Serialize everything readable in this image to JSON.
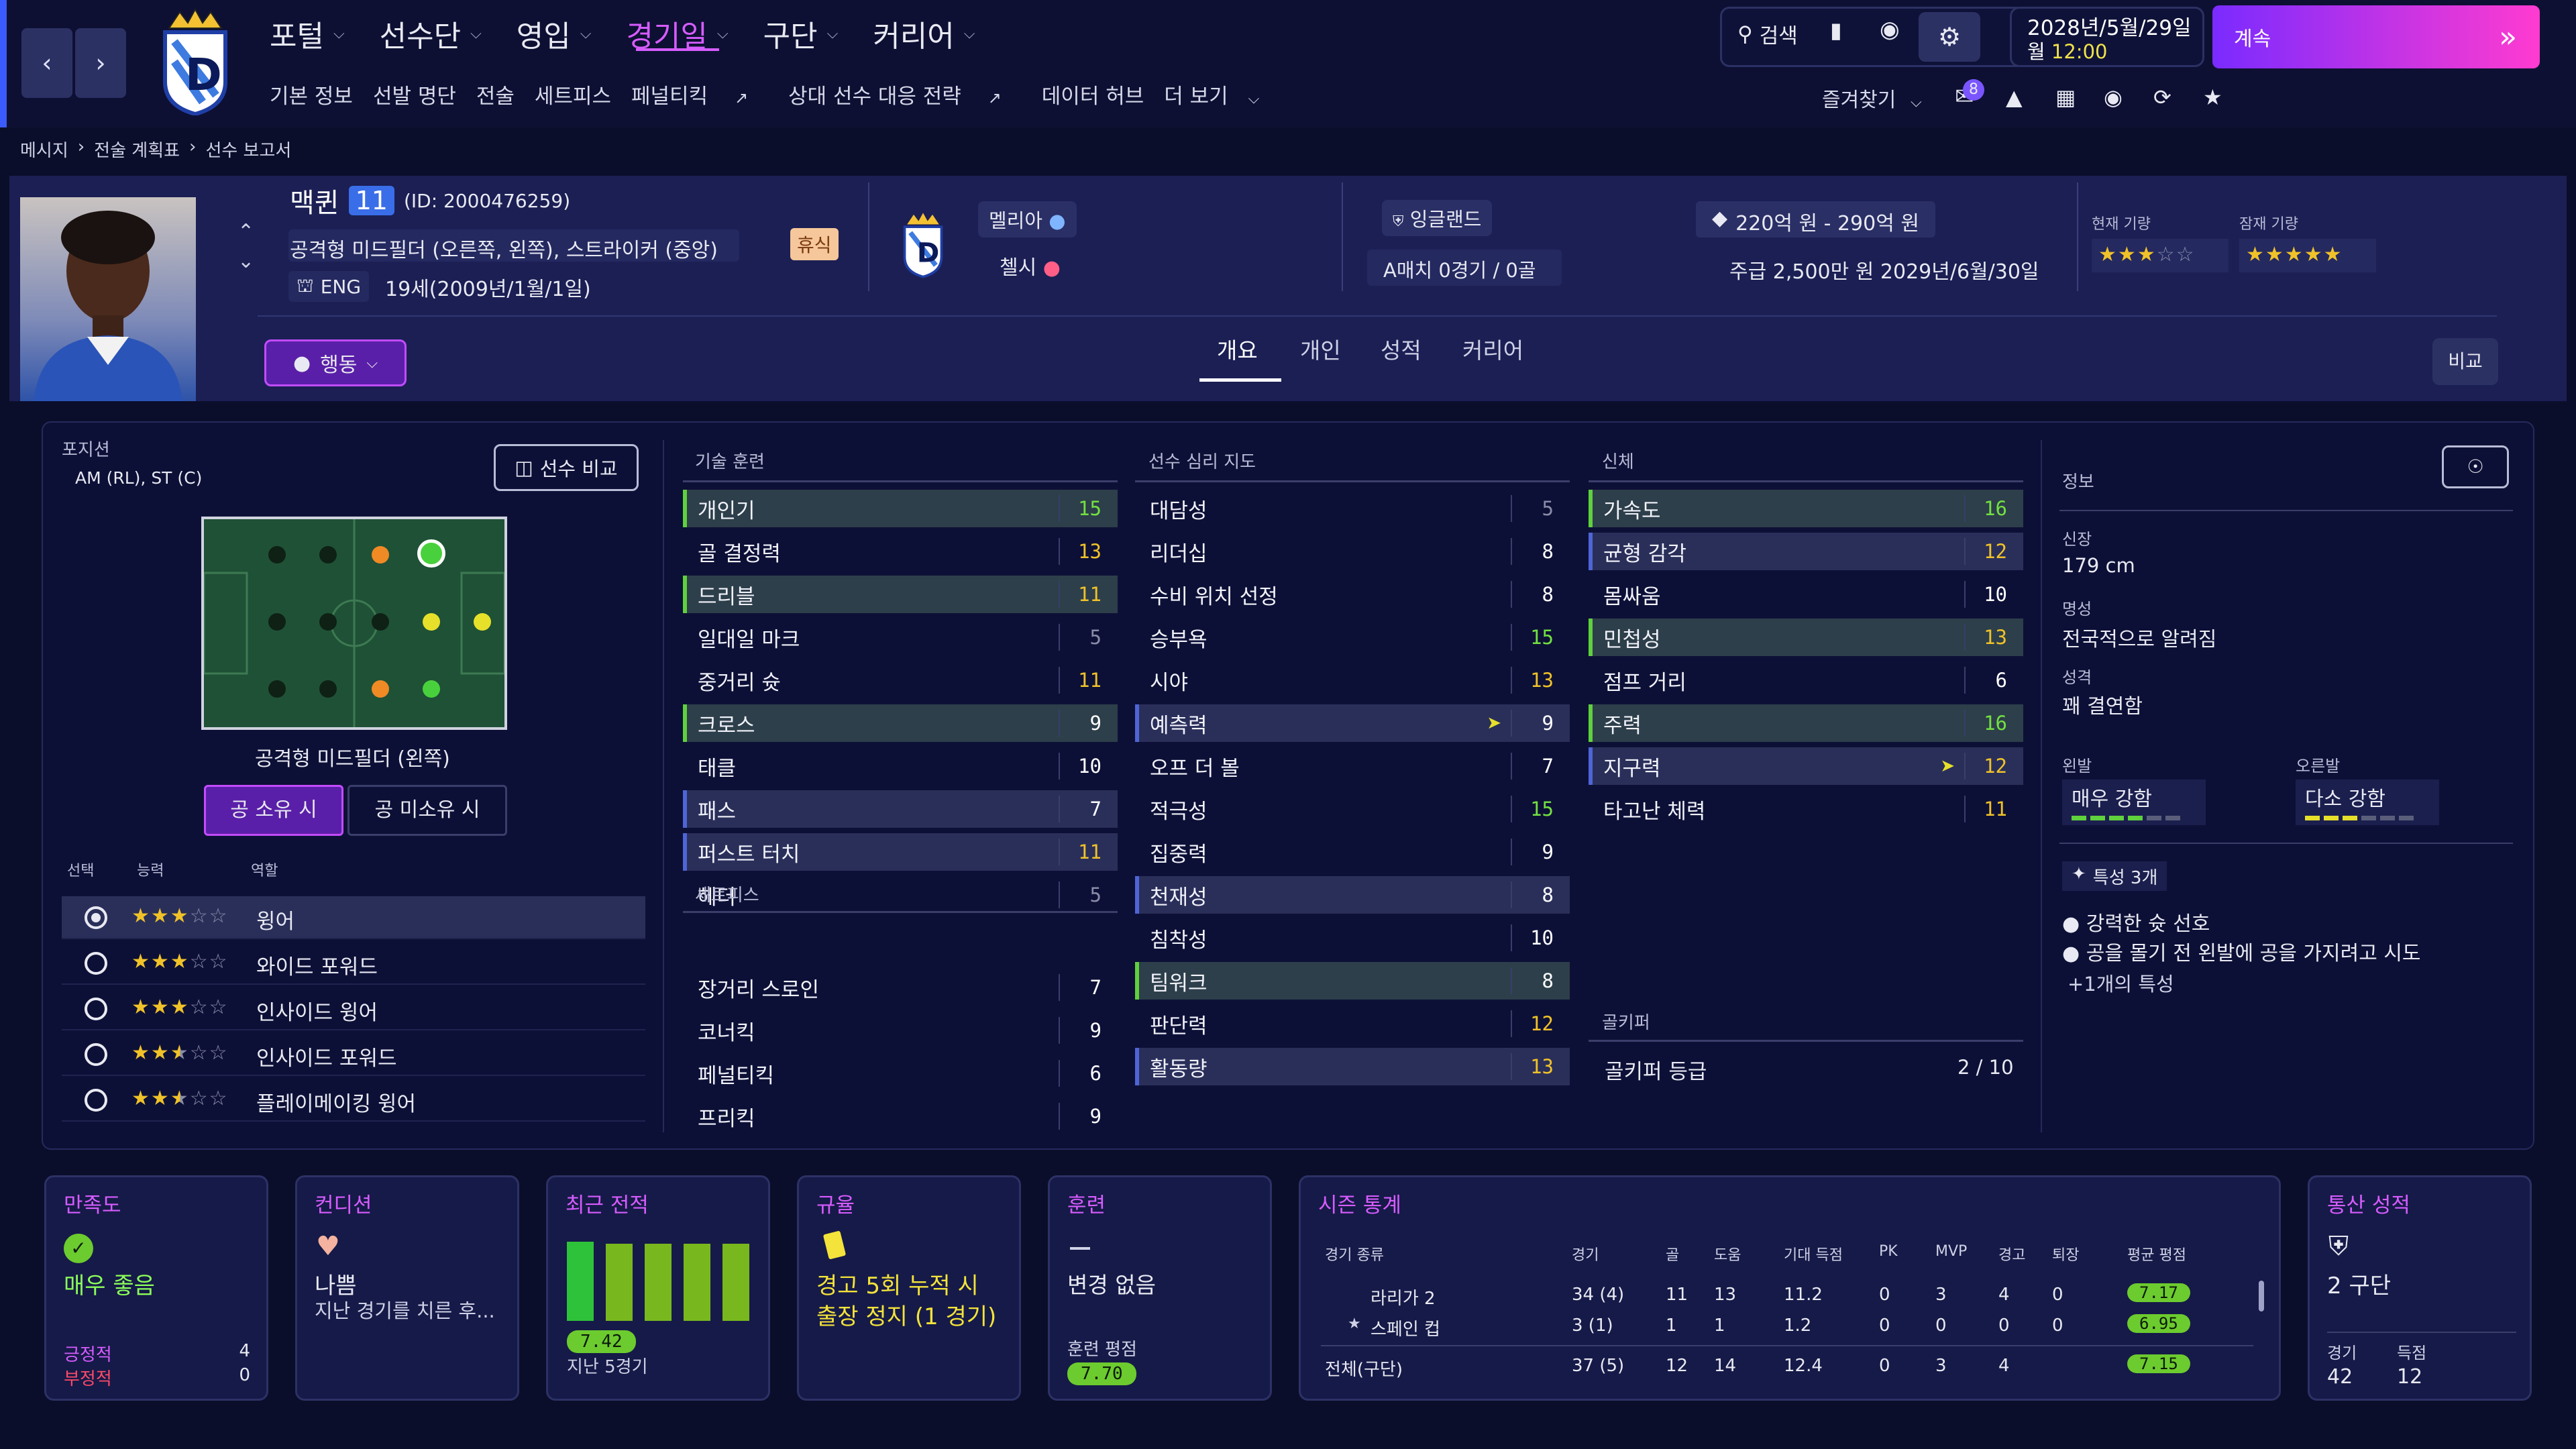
{
  "topbar": {
    "nav": [
      {
        "label": "포털",
        "active": false
      },
      {
        "label": "선수단",
        "active": false
      },
      {
        "label": "영입",
        "active": false
      },
      {
        "label": "경기일",
        "active": true
      },
      {
        "label": "구단",
        "active": false
      },
      {
        "label": "커리어",
        "active": false
      }
    ],
    "subnav": [
      "기본 정보",
      "선발 명단",
      "전술",
      "세트피스",
      "페널티킥",
      "상대 선수 대응 전략",
      "데이터 허브",
      "더 보기"
    ],
    "search_label": "검색",
    "date": "2028년/5월/29일",
    "day": "월",
    "time": "12:00",
    "continue_label": "계속",
    "favorites_label": "즐겨찾기",
    "notification_count": "8",
    "colors": {
      "accent": "#d65cff",
      "continue_start": "#7a2bff",
      "continue_end": "#ff3bd0"
    }
  },
  "breadcrumb": [
    "메시지",
    "전술 계획표",
    "선수 보고서"
  ],
  "player": {
    "name": "맥퀸",
    "number": "11",
    "id": "(ID: 2000476259)",
    "positions": "공격형 미드필더 (오른쪽, 왼쪽), 스트라이커 (중앙)",
    "status": "휴식",
    "nation": "ENG",
    "age": "19세(2009년/1월/1일)",
    "club": "멜리아",
    "loan_club": "첼시",
    "national_team": "잉글랜드",
    "caps": "A매치 0경기 / 0골",
    "value": "220억 원 - 290억 원",
    "contract": "주급 2,500만 원 2029년/6월/30일",
    "current_ability_label": "현재 기량",
    "current_ability": 3,
    "potential_label": "잠재 기량",
    "potential": 5,
    "action_label": "행동",
    "compare_label": "비교"
  },
  "tabs": [
    "개요",
    "개인",
    "성적",
    "커리어"
  ],
  "position_panel": {
    "title": "포지션",
    "positions_short": "AM (RL), ST (C)",
    "compare_button": "선수 비교",
    "selected_position": "공격형 미드필더 (왼쪽)",
    "toggle": [
      "공 소유 시",
      "공 미소유 시"
    ],
    "headers": [
      "선택",
      "능력",
      "역할"
    ],
    "roles": [
      {
        "name": "윙어",
        "stars": 3,
        "selected": true
      },
      {
        "name": "와이드 포워드",
        "stars": 3,
        "selected": false
      },
      {
        "name": "인사이드 윙어",
        "stars": 3,
        "selected": false
      },
      {
        "name": "인사이드 포워드",
        "stars": 2.5,
        "selected": false
      },
      {
        "name": "플레이메이킹 윙어",
        "stars": 2.5,
        "selected": false
      }
    ]
  },
  "technical": {
    "title": "기술 훈련",
    "attrs": [
      {
        "name": "개인기",
        "value": "15",
        "style": "g"
      },
      {
        "name": "골 결정력",
        "value": "13",
        "style": ""
      },
      {
        "name": "드리블",
        "value": "11",
        "style": "g"
      },
      {
        "name": "일대일 마크",
        "value": "5",
        "style": ""
      },
      {
        "name": "중거리 슛",
        "value": "11",
        "style": ""
      },
      {
        "name": "크로스",
        "value": "9",
        "style": "g"
      },
      {
        "name": "태클",
        "value": "10",
        "style": ""
      },
      {
        "name": "패스",
        "value": "7",
        "style": "b"
      },
      {
        "name": "퍼스트 터치",
        "value": "11",
        "style": "b"
      },
      {
        "name": "헤더",
        "value": "5",
        "style": ""
      }
    ],
    "setpiece_title": "세트피스",
    "setpieces": [
      {
        "name": "장거리 스로인",
        "value": "7",
        "style": ""
      },
      {
        "name": "코너킥",
        "value": "9",
        "style": ""
      },
      {
        "name": "페널티킥",
        "value": "6",
        "style": ""
      },
      {
        "name": "프리킥",
        "value": "9",
        "style": ""
      }
    ]
  },
  "mental": {
    "title": "선수 심리 지도",
    "attrs": [
      {
        "name": "대담성",
        "value": "5",
        "style": ""
      },
      {
        "name": "리더십",
        "value": "8",
        "style": ""
      },
      {
        "name": "수비 위치 선정",
        "value": "8",
        "style": ""
      },
      {
        "name": "승부욕",
        "value": "15",
        "style": ""
      },
      {
        "name": "시야",
        "value": "13",
        "style": ""
      },
      {
        "name": "예측력",
        "value": "9",
        "style": "b"
      },
      {
        "name": "오프 더 볼",
        "value": "7",
        "style": ""
      },
      {
        "name": "적극성",
        "value": "15",
        "style": ""
      },
      {
        "name": "집중력",
        "value": "9",
        "style": ""
      },
      {
        "name": "천재성",
        "value": "8",
        "style": "b"
      },
      {
        "name": "침착성",
        "value": "10",
        "style": ""
      },
      {
        "name": "팀워크",
        "value": "8",
        "style": "g"
      },
      {
        "name": "판단력",
        "value": "12",
        "style": ""
      },
      {
        "name": "활동량",
        "value": "13",
        "style": "b"
      }
    ]
  },
  "physical": {
    "title": "신체",
    "attrs": [
      {
        "name": "가속도",
        "value": "16",
        "style": "g"
      },
      {
        "name": "균형 감각",
        "value": "12",
        "style": "b"
      },
      {
        "name": "몸싸움",
        "value": "10",
        "style": ""
      },
      {
        "name": "민첩성",
        "value": "13",
        "style": "g"
      },
      {
        "name": "점프 거리",
        "value": "6",
        "style": ""
      },
      {
        "name": "주력",
        "value": "16",
        "style": "g"
      },
      {
        "name": "지구력",
        "value": "12",
        "style": "b"
      },
      {
        "name": "타고난 체력",
        "value": "11",
        "style": ""
      }
    ],
    "gk_title": "골키퍼",
    "gk_label": "골키퍼 등급",
    "gk_value": "2 / 10"
  },
  "info": {
    "title": "정보",
    "height_label": "신장",
    "height": "179 cm",
    "fame_label": "명성",
    "fame": "전국적으로 알려짐",
    "personality_label": "성격",
    "personality": "꽤 결연함",
    "left_foot_label": "왼발",
    "left_foot": "매우 강함",
    "left_foot_level": 0.8,
    "right_foot_label": "오른발",
    "right_foot": "다소 강함",
    "right_foot_level": 0.6,
    "traits_label": "특성 3개",
    "traits": [
      "강력한 슛 선호",
      "공을 몰기 전 왼발에 공을 가지려고 시도"
    ],
    "more_traits": "+1개의 특성"
  },
  "cards": {
    "morale": {
      "title": "만족도",
      "value": "매우 좋음",
      "pos_label": "긍정적",
      "pos": "4",
      "neg_label": "부정적",
      "neg": "0"
    },
    "condition": {
      "title": "컨디션",
      "value": "나쁨",
      "sub": "지난 경기를 치른 후..."
    },
    "form": {
      "title": "최근 전적",
      "rating": "7.42",
      "label": "지난 5경기",
      "bars": [
        0.95,
        0.93,
        0.93,
        0.93,
        0.93
      ]
    },
    "discipline": {
      "title": "규율",
      "line1": "경고 5회 누적 시",
      "line2": "출장 정지 (1 경기)"
    },
    "training": {
      "title": "훈련",
      "value": "변경 없음",
      "rating_label": "훈련 평점",
      "rating": "7.70"
    },
    "season": {
      "title": "시즌 통계",
      "headers": [
        "경기 종류",
        "경기",
        "골",
        "도움",
        "기대 득점",
        "PK",
        "MVP",
        "경고",
        "퇴장",
        "평균 평점"
      ],
      "rows": [
        [
          "라리가 2",
          "34 (4)",
          "11",
          "13",
          "11.2",
          "0",
          "3",
          "4",
          "0",
          "7.17"
        ],
        [
          "스페인 컵",
          "3 (1)",
          "1",
          "1",
          "1.2",
          "0",
          "0",
          "0",
          "0",
          "6.95"
        ],
        [
          "전체(구단)",
          "37 (5)",
          "12",
          "14",
          "12.4",
          "0",
          "3",
          "4",
          "",
          "7.15"
        ]
      ]
    },
    "career": {
      "title": "통산 성적",
      "value": "2 구단",
      "games_label": "경기",
      "games": "42",
      "goals_label": "득점",
      "goals": "12"
    }
  }
}
